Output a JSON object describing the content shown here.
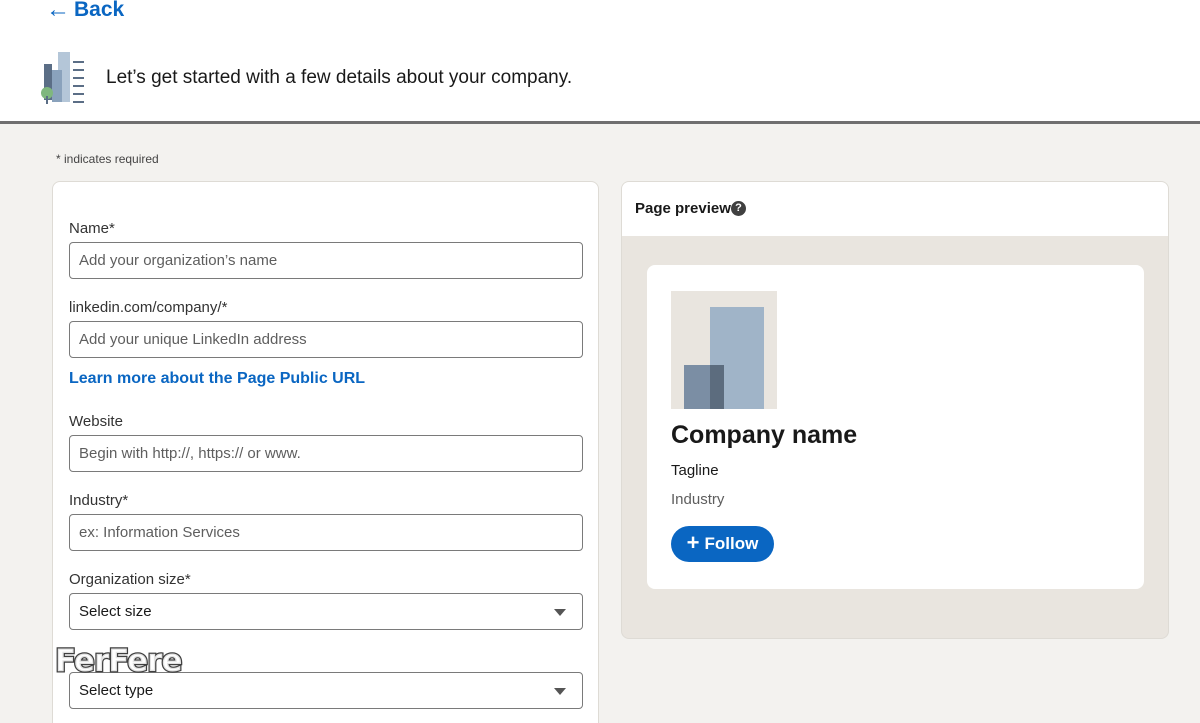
{
  "header": {
    "back_label": "Back",
    "back_arrow": "←",
    "intro_text": "Let’s get started with a few details about your company."
  },
  "required_note": "*  indicates required",
  "form": {
    "name": {
      "label": "Name*",
      "placeholder": "Add your organization’s name"
    },
    "url": {
      "label": "linkedin.com/company/*",
      "placeholder": "Add your unique LinkedIn address"
    },
    "learn_link": "Learn more about the Page Public URL",
    "website": {
      "label": "Website",
      "placeholder": "Begin with http://, https:// or www."
    },
    "industry": {
      "label": "Industry*",
      "placeholder": "ex: Information Services"
    },
    "org_size": {
      "label": "Organization size*",
      "value": "Select size"
    },
    "org_type": {
      "value": "Select type"
    }
  },
  "watermark": "FerFere",
  "preview": {
    "title": "Page preview",
    "help_glyph": "?",
    "company_name": "Company name",
    "tagline": "Tagline",
    "industry": "Industry",
    "follow_label": "Follow",
    "follow_glyph": "+"
  },
  "colors": {
    "accent": "#0a66c2",
    "background": "#f3f2ef",
    "preview_bg": "#e9e5df"
  },
  "icons": [
    "back-arrow-icon",
    "building-icon",
    "help-icon",
    "chevron-down-icon",
    "plus-icon"
  ]
}
